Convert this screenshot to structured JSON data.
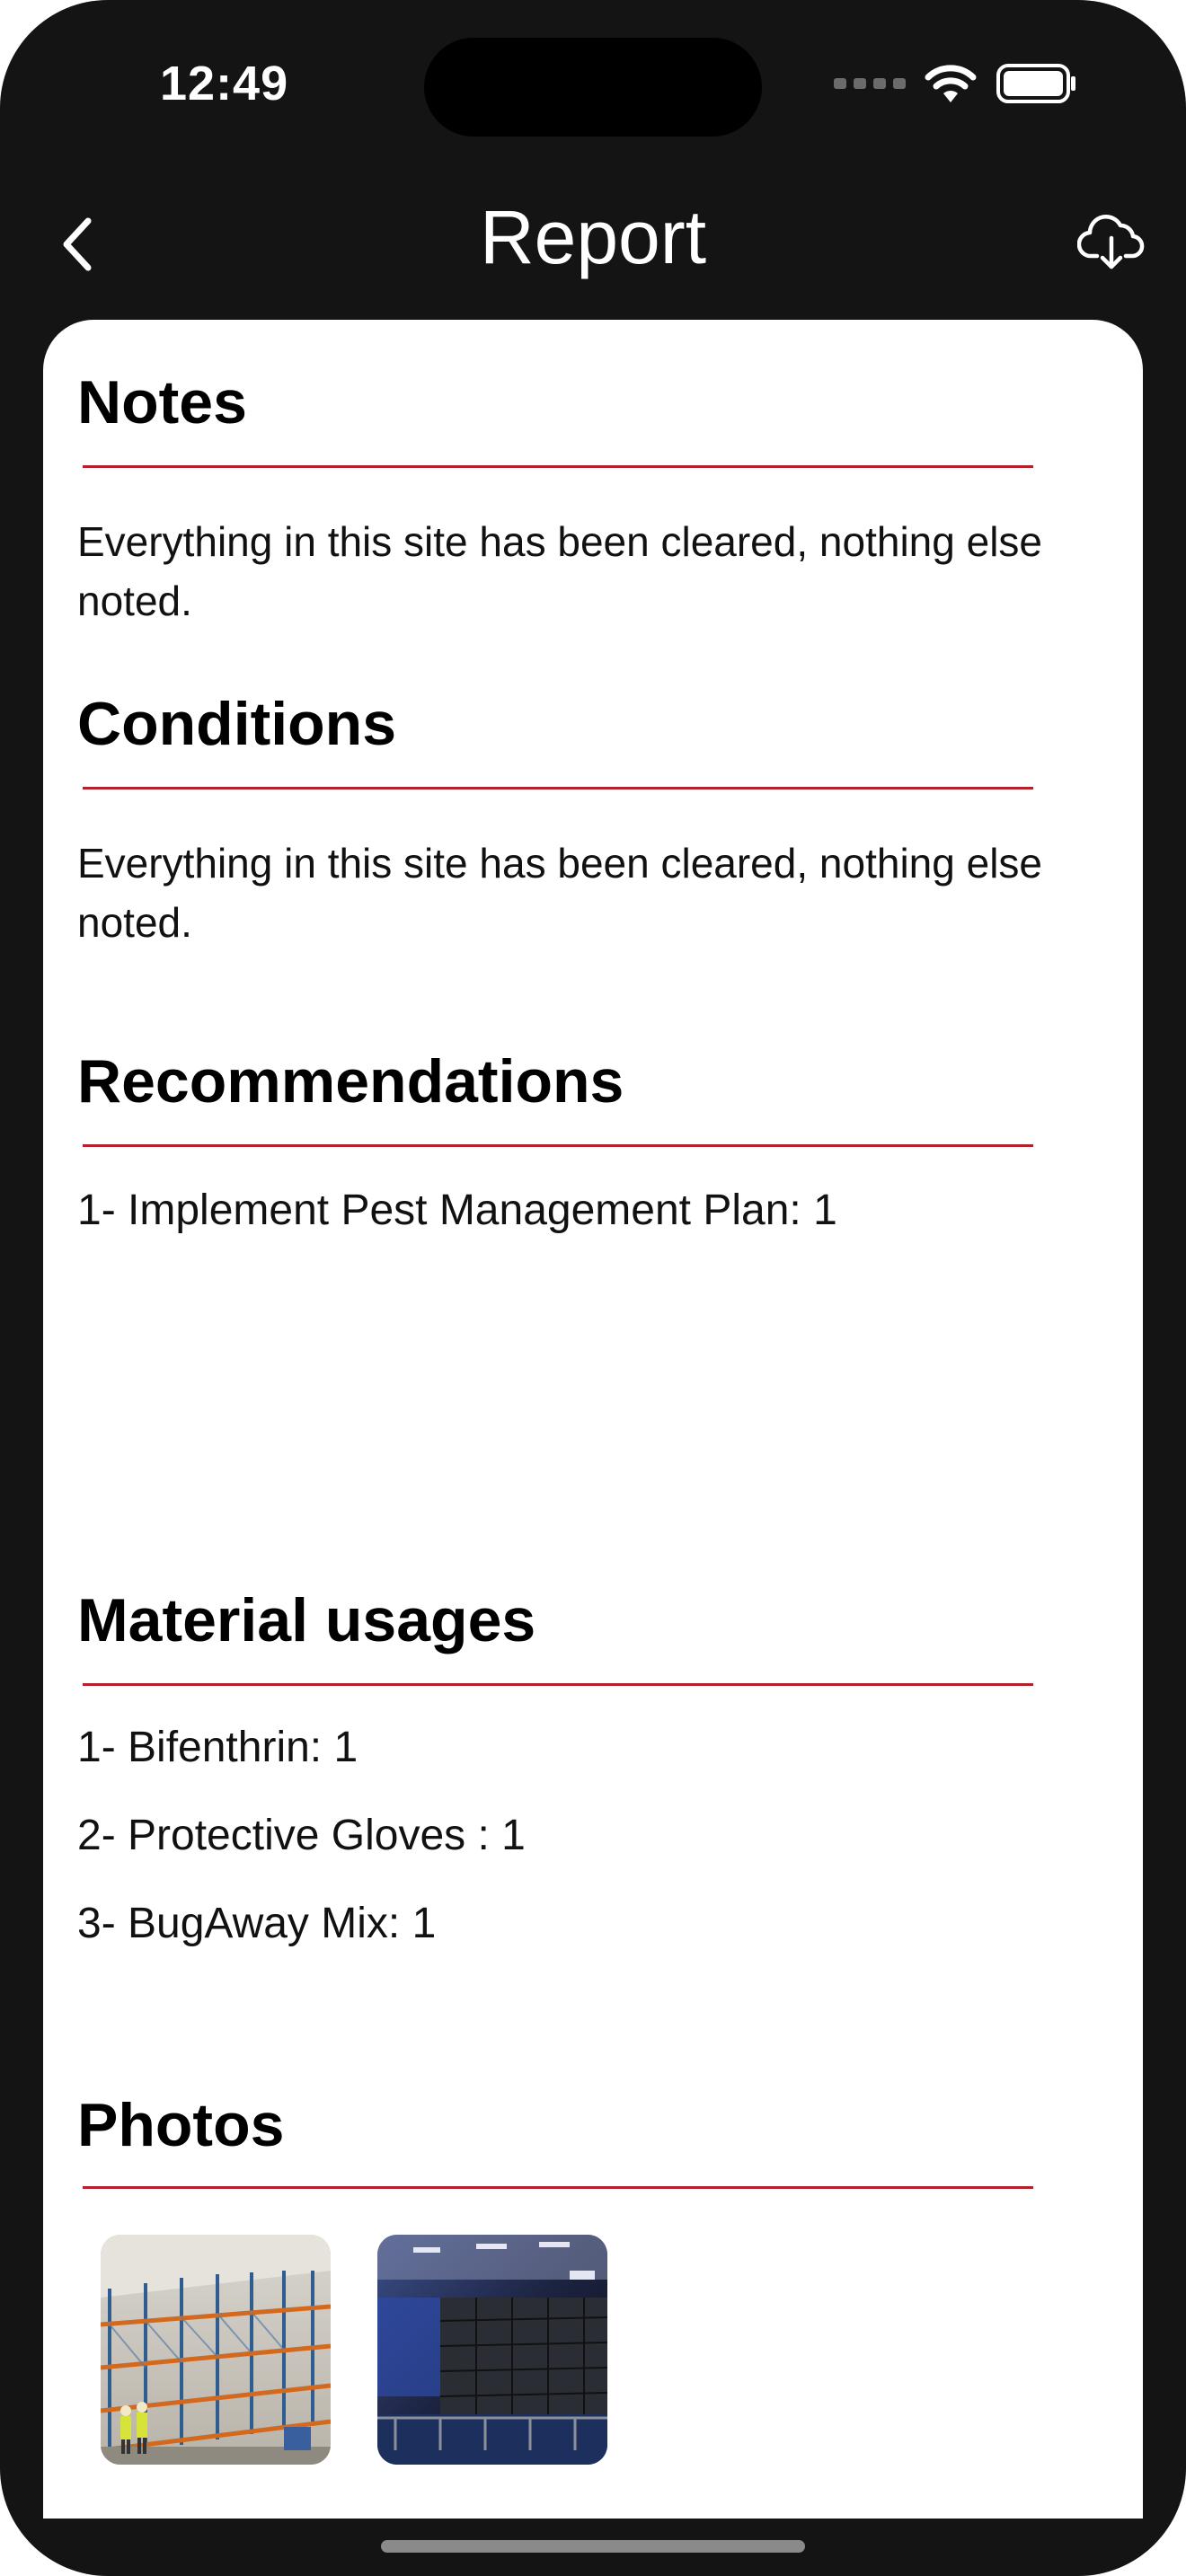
{
  "status_bar": {
    "time": "12:49"
  },
  "nav": {
    "title": "Report"
  },
  "sections": {
    "notes": {
      "title": "Notes",
      "body": "Everything in this site has been cleared, nothing else noted."
    },
    "conditions": {
      "title": "Conditions",
      "body": "Everything in this site has been cleared, nothing else noted."
    },
    "recommendations": {
      "title": "Recommendations",
      "items": [
        "1- Implement Pest Management Plan: 1"
      ]
    },
    "material_usages": {
      "title": "Material usages",
      "items": [
        "1- Bifenthrin: 1",
        "2- Protective Gloves : 1",
        "3- BugAway Mix: 1"
      ]
    },
    "photos": {
      "title": "Photos",
      "items": [
        {
          "icon": "warehouse-racking-photo"
        },
        {
          "icon": "warehouse-interior-photo"
        }
      ]
    }
  },
  "colors": {
    "background": "#141414",
    "card": "#ffffff",
    "accent_divider": "#b3222a"
  }
}
